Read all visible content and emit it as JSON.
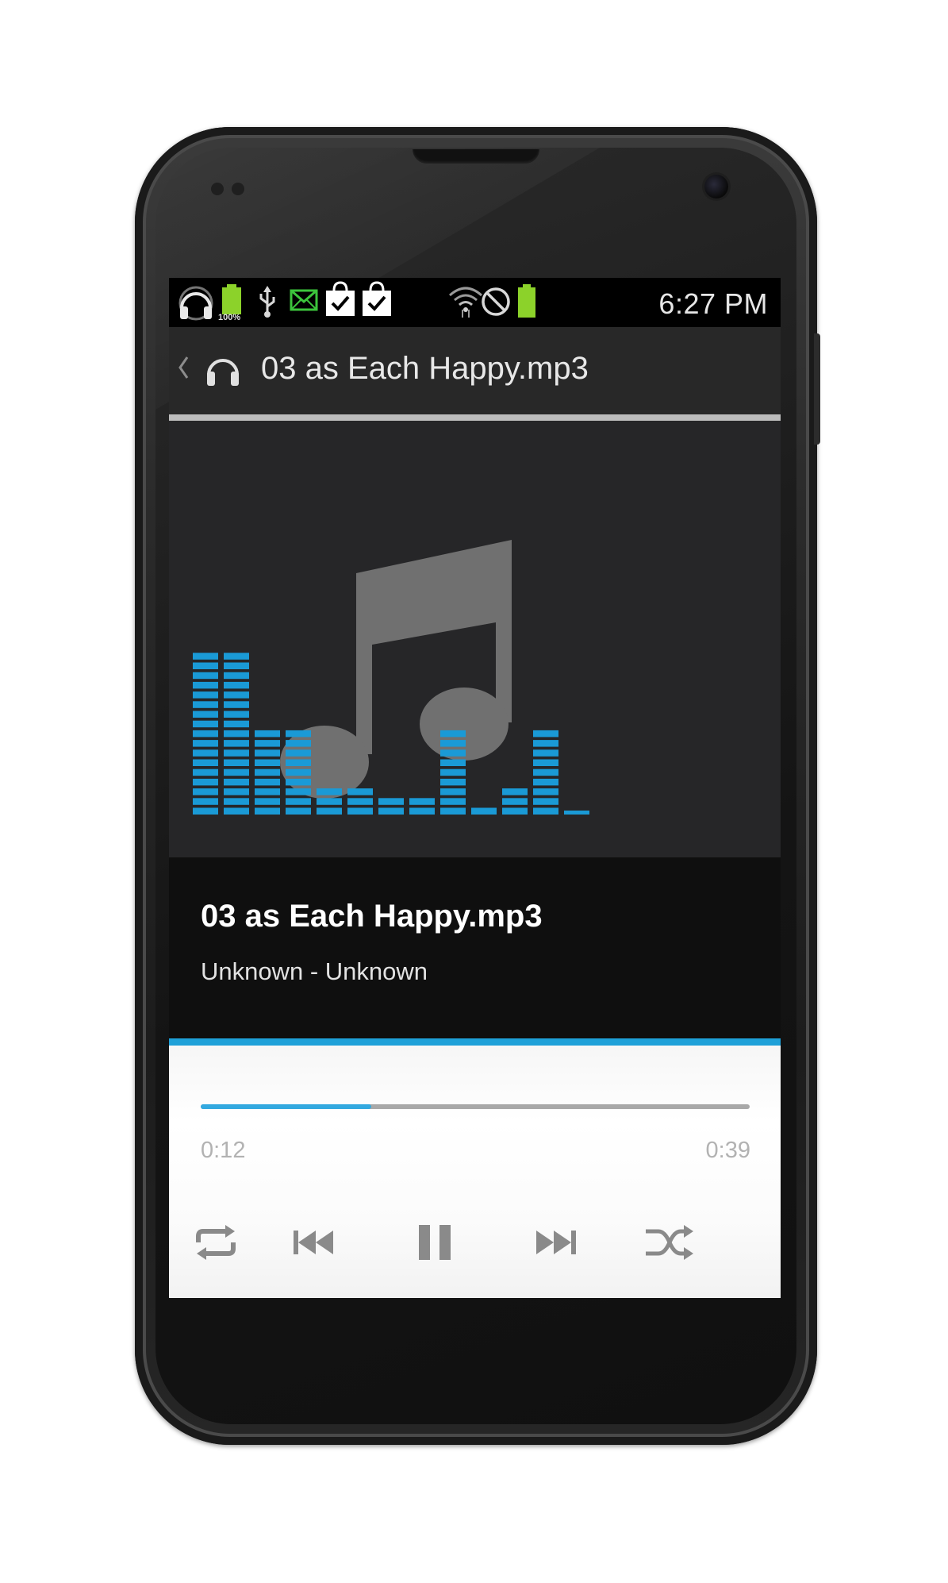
{
  "status_bar": {
    "time": "6:27 PM",
    "battery_small_label": "100%",
    "icons": [
      "headphones-icon",
      "battery-full-icon",
      "usb-icon",
      "mail-icon",
      "shopping-bag-check-icon",
      "shopping-bag-check-icon",
      "wifi-icon",
      "no-signal-icon",
      "battery-icon"
    ]
  },
  "action_bar": {
    "title": "03 as Each Happy.mp3",
    "icon": "headphones-icon"
  },
  "now_playing": {
    "title": "03 as Each Happy.mp3",
    "subtitle": "Unknown - Unknown"
  },
  "progress": {
    "elapsed": "0:12",
    "total": "0:39",
    "fraction": 0.31
  },
  "controls": {
    "buttons": [
      "repeat-icon",
      "previous-icon",
      "pause-icon",
      "next-icon",
      "shuffle-icon"
    ]
  },
  "visualizer": {
    "bar_levels": [
      17,
      17,
      9,
      9,
      3,
      3,
      2,
      2,
      9,
      1,
      3,
      9,
      0
    ],
    "color": "#1a9ad6"
  },
  "colors": {
    "accent": "#1ea0d8",
    "status_bar": "#000000",
    "action_bar": "#282828",
    "info_panel": "#0f0f0f"
  }
}
